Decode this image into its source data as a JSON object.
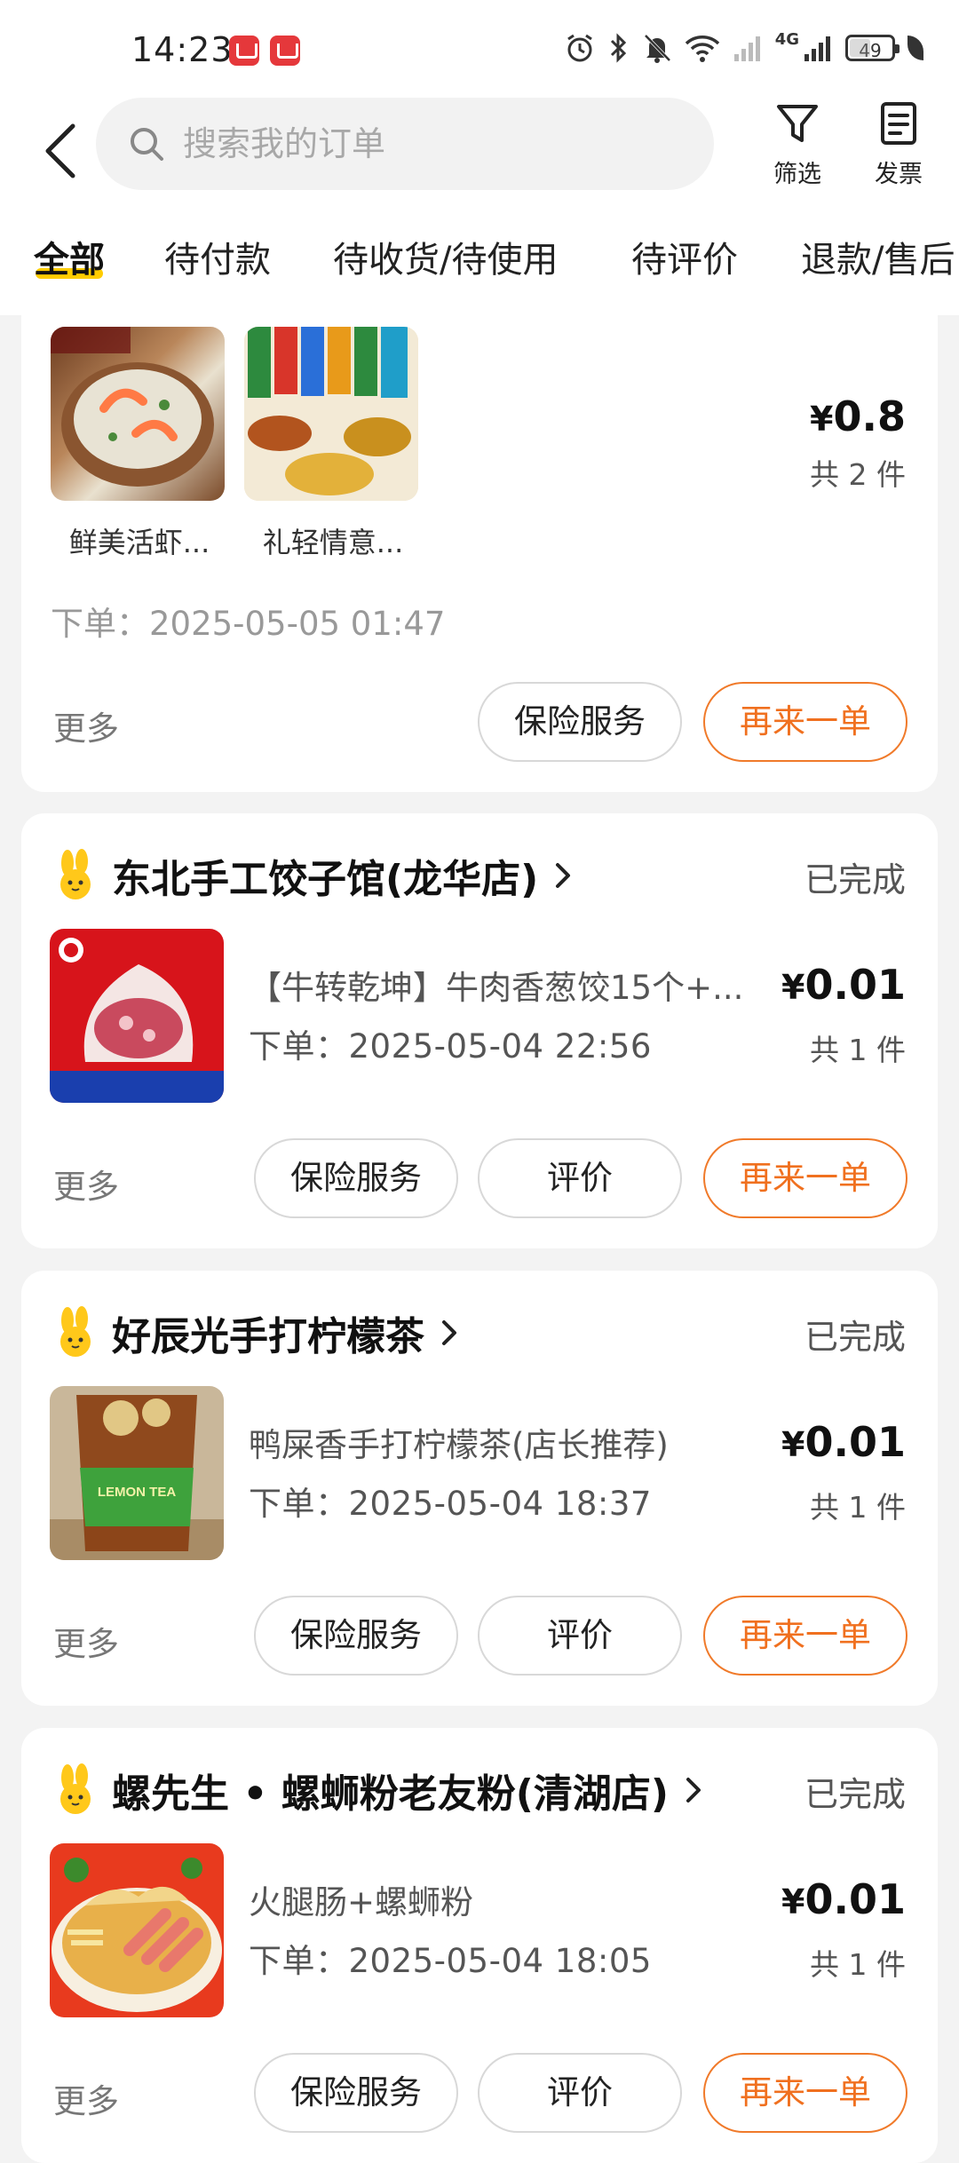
{
  "status_bar": {
    "time": "14:23",
    "network": "4G",
    "battery": "49"
  },
  "search": {
    "placeholder": "搜索我的订单"
  },
  "actions": {
    "filter_label": "筛选",
    "invoice_label": "发票"
  },
  "tabs": [
    {
      "label": "全部",
      "active": true
    },
    {
      "label": "待付款"
    },
    {
      "label": "待收货/待使用"
    },
    {
      "label": "待评价"
    },
    {
      "label": "退款/售后"
    }
  ],
  "orders": [
    {
      "items": [
        {
          "caption": "鲜美活虾..."
        },
        {
          "caption": "礼轻情意..."
        }
      ],
      "price_currency": "¥",
      "price_value": "0.8",
      "count": "共 2 件",
      "order_time": "下单：2025-05-05 01:47",
      "more": "更多",
      "buttons": [
        "保险服务",
        "再来一单"
      ]
    },
    {
      "shop": "东北手工饺子馆(龙华店)",
      "status": "已完成",
      "title": "【牛转乾坤】牛肉香葱饺15个+...",
      "order_time": "下单：2025-05-04 22:56",
      "price_currency": "¥",
      "price_value": "0.01",
      "count": "共 1 件",
      "more": "更多",
      "buttons": [
        "保险服务",
        "评价",
        "再来一单"
      ]
    },
    {
      "shop": "好辰光手打柠檬茶",
      "status": "已完成",
      "title": "鸭屎香手打柠檬茶(店长推荐)",
      "order_time": "下单：2025-05-04 18:37",
      "price_currency": "¥",
      "price_value": "0.01",
      "count": "共 1 件",
      "more": "更多",
      "buttons": [
        "保险服务",
        "评价",
        "再来一单"
      ],
      "img_text": "LEMON TEA"
    },
    {
      "shop": "螺先生 • 螺蛳粉老友粉(清湖店)",
      "status": "已完成",
      "title": "火腿肠+螺蛳粉",
      "order_time": "下单：2025-05-04 18:05",
      "price_currency": "¥",
      "price_value": "0.01",
      "count": "共 1 件",
      "more": "更多",
      "buttons": [
        "保险服务",
        "评价",
        "再来一单"
      ]
    }
  ],
  "colors": {
    "accent_orange": "#f0701f",
    "tab_underline": "#ffcc00",
    "page_bg": "#f3f3f3"
  },
  "icons": [
    "back-arrow-icon",
    "search-icon",
    "filter-funnel-icon",
    "invoice-icon",
    "shop-bunny-icon",
    "chevron-right-icon"
  ]
}
